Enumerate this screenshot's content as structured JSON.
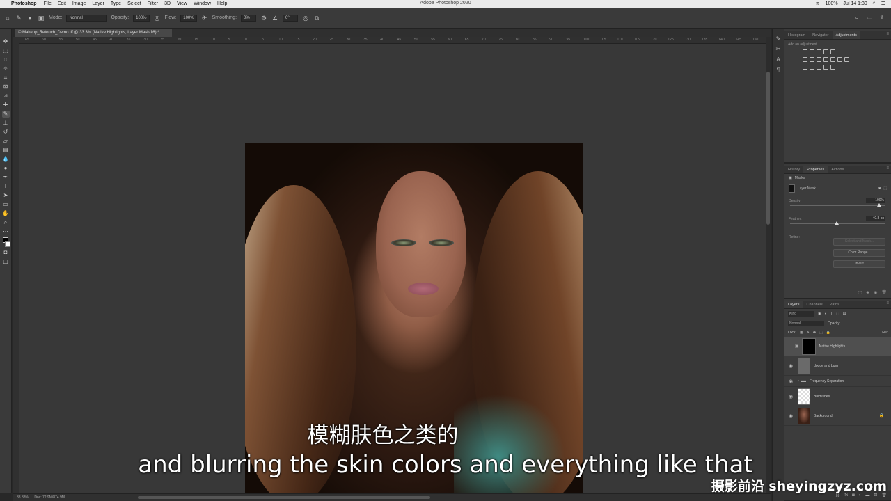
{
  "menubar": {
    "app_name": "Photoshop",
    "items": [
      "File",
      "Edit",
      "Image",
      "Layer",
      "Type",
      "Select",
      "Filter",
      "3D",
      "View",
      "Window",
      "Help"
    ],
    "window_title": "Adobe Photoshop 2020",
    "battery": "100%",
    "clock": "Jul 14  1:30"
  },
  "options_bar": {
    "mode_label": "Mode:",
    "mode_value": "Normal",
    "opacity_label": "Opacity:",
    "opacity_value": "100%",
    "flow_label": "Flow:",
    "flow_value": "100%",
    "smoothing_label": "Smoothing:",
    "smoothing_value": "0%",
    "angle_value": "0°"
  },
  "document": {
    "tab_title": "© Makeup_Retouch_Demo.tif @ 33.3% (Native Highlights, Layer Mask/16) *",
    "zoom": "33.33%",
    "doc_info": "Doc: 72.9M/874.9M"
  },
  "ruler_ticks": [
    "65",
    "60",
    "55",
    "50",
    "45",
    "40",
    "35",
    "30",
    "25",
    "20",
    "15",
    "10",
    "5",
    "0",
    "5",
    "10",
    "15",
    "20",
    "25",
    "30",
    "35",
    "40",
    "45",
    "50",
    "55",
    "60",
    "65",
    "70",
    "75",
    "80",
    "85",
    "90",
    "95",
    "100",
    "105",
    "110",
    "115",
    "120",
    "125",
    "130",
    "135",
    "140",
    "145",
    "150"
  ],
  "subtitles": {
    "chinese": "模糊肤色之类的",
    "english": "and blurring the skin colors and everything like that",
    "watermark": "摄影前沿 sheyingzyz.com"
  },
  "panels": {
    "top_tabs": [
      "Histogram",
      "Navigator",
      "Adjustments"
    ],
    "adjustments_hint": "Add an adjustment",
    "mid_tabs": [
      "History",
      "Properties",
      "Actions"
    ],
    "props_title": "Masks",
    "layer_mask_label": "Layer Mask",
    "density_label": "Density:",
    "density_value": "100%",
    "feather_label": "Feather:",
    "feather_value": "40.8 px",
    "refine_label": "Refine:",
    "select_mask_btn": "Select and Mask...",
    "color_range_btn": "Color Range...",
    "invert_btn": "Invert",
    "layers_tabs": [
      "Layers",
      "Channels",
      "Paths"
    ],
    "kind_label": "Kind",
    "blend_mode": "Normal",
    "opacity_label": "Opacity:",
    "lock_label": "Lock:",
    "fill_label": "Fill:"
  },
  "layers": [
    {
      "name": "Native Highlights",
      "thumb": "gray",
      "mask": true,
      "selected": true,
      "visible": false
    },
    {
      "name": "dodge and burn",
      "thumb": "gray",
      "mask": false,
      "selected": false,
      "visible": true
    },
    {
      "name": "Frequency Separation",
      "thumb": "folder",
      "mask": false,
      "selected": false,
      "visible": true
    },
    {
      "name": "Blemishes",
      "thumb": "check",
      "mask": false,
      "selected": false,
      "visible": true
    },
    {
      "name": "Background",
      "thumb": "photo",
      "mask": false,
      "selected": false,
      "visible": true,
      "locked": true
    }
  ]
}
